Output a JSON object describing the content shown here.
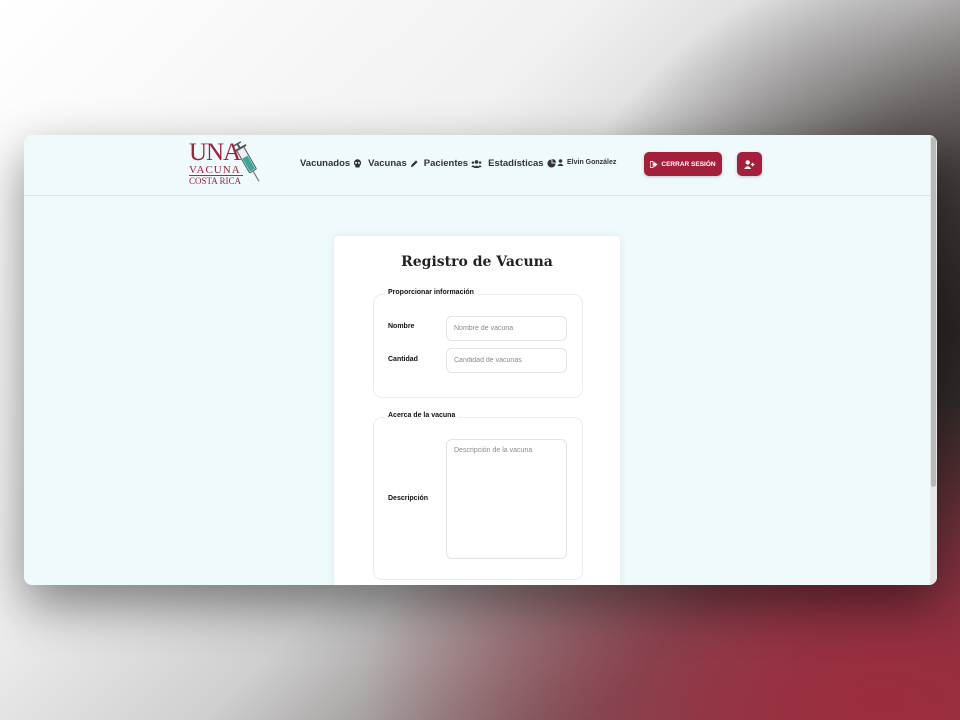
{
  "logo": {
    "line1": "UNA",
    "line2": "VACUNA",
    "line3": "COSTA RICA"
  },
  "nav": {
    "links": [
      {
        "label": "Vacunados",
        "icon": "skull-icon"
      },
      {
        "label": "Vacunas",
        "icon": "pencil-icon"
      },
      {
        "label": "Pacientes",
        "icon": "users-icon"
      },
      {
        "label": "Estadísticas",
        "icon": "pie-chart-icon"
      }
    ],
    "user_name": "Elvin González",
    "logout_label": "CERRAR SESIÓN"
  },
  "form": {
    "title": "Registro de Vacuna",
    "section1": {
      "legend": "Proporcionar información",
      "name_label": "Nombre",
      "name_placeholder": "Nombre de vacuna",
      "qty_label": "Cantidad",
      "qty_placeholder": "Candidad de vacunas"
    },
    "section2": {
      "legend": "Acerca de la vacuna",
      "desc_label": "Descripción",
      "desc_placeholder": "Descripción de la vacuna"
    }
  },
  "colors": {
    "brand": "#a4203a",
    "page_bg": "#eefafc"
  }
}
